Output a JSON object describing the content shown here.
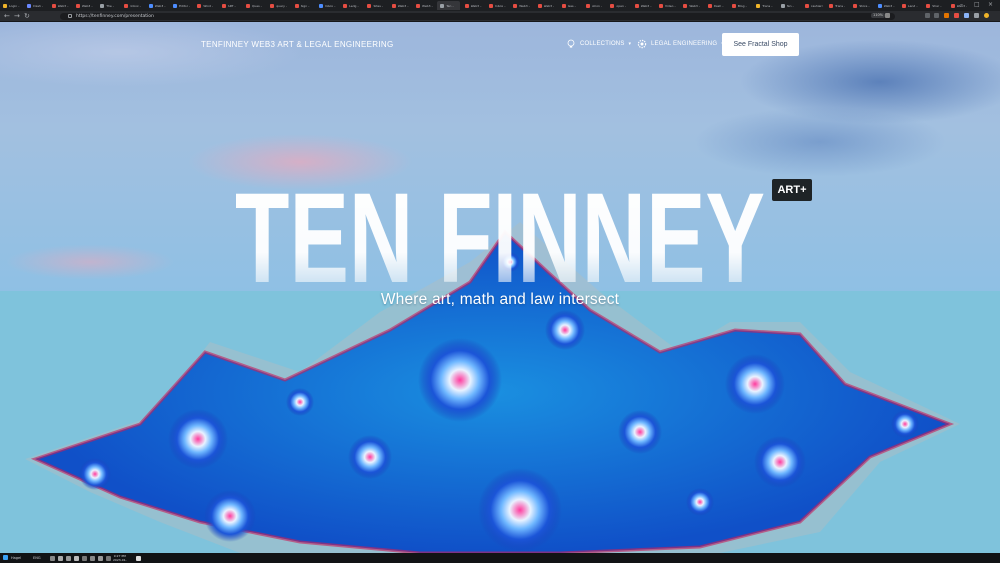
{
  "browser": {
    "tabs": [
      {
        "title": "Login –",
        "color": "#f0b429"
      },
      {
        "title": "Dash –",
        "color": "#6a88ff"
      },
      {
        "title": "Web3 –",
        "color": "#e54d42"
      },
      {
        "title": "Web3 –",
        "color": "#e54d42"
      },
      {
        "title": "The –",
        "color": "#9aa0a6"
      },
      {
        "title": "Inbox –",
        "color": "#e54d42"
      },
      {
        "title": "Web3 –",
        "color": "#4d8dff"
      },
      {
        "title": "Editor –",
        "color": "#4d8dff"
      },
      {
        "title": "Wind –",
        "color": "#e54d42"
      },
      {
        "title": "ART –",
        "color": "#e54d42"
      },
      {
        "title": "Ques –",
        "color": "#e54d42"
      },
      {
        "title": "query –",
        "color": "#e54d42"
      },
      {
        "title": "Sign –",
        "color": "#e54d42"
      },
      {
        "title": "Inbox –",
        "color": "#4d8dff"
      },
      {
        "title": "Ledg –",
        "color": "#e54d42"
      },
      {
        "title": "Sites –",
        "color": "#e54d42"
      },
      {
        "title": "Web3 –",
        "color": "#e54d42"
      },
      {
        "title": "Web3 –",
        "color": "#e54d42"
      },
      {
        "title": "Ten –",
        "color": "#9aa0a6",
        "active": true
      },
      {
        "title": "Web3 –",
        "color": "#e54d42"
      },
      {
        "title": "Inbox –",
        "color": "#e54d42"
      },
      {
        "title": "Web3 –",
        "color": "#e54d42"
      },
      {
        "title": "Web3 –",
        "color": "#e54d42"
      },
      {
        "title": "Gas –",
        "color": "#e54d42"
      },
      {
        "title": "ACon –",
        "color": "#e54d42"
      },
      {
        "title": "open –",
        "color": "#e54d42"
      },
      {
        "title": "Web3 –",
        "color": "#e54d42"
      },
      {
        "title": "Video –",
        "color": "#e54d42"
      },
      {
        "title": "Web3 –",
        "color": "#e54d42"
      },
      {
        "title": "Dash –",
        "color": "#e54d42"
      },
      {
        "title": "Blog –",
        "color": "#e54d42"
      },
      {
        "title": "Trans –",
        "color": "#f0b429"
      },
      {
        "title": "Ten –",
        "color": "#9aa0a6"
      },
      {
        "title": "cashierr –",
        "color": "#e54d42"
      },
      {
        "title": "Trans –",
        "color": "#e54d42"
      },
      {
        "title": "Store –",
        "color": "#e54d42"
      },
      {
        "title": "Web3 –",
        "color": "#4d8dff"
      },
      {
        "title": "Land –",
        "color": "#e54d42"
      },
      {
        "title": "Shar –",
        "color": "#e54d42"
      },
      {
        "title": "Web3 –",
        "color": "#e54d42"
      }
    ],
    "url": "https://tenfinney.com/presentation",
    "zoom": "110%"
  },
  "nav": {
    "brand": "TENFINNEY WEB3 ART & LEGAL ENGINEERING",
    "collections": "COLLECTIONS",
    "legal_engineering": "LEGAL ENGINEERING",
    "shop_button": "See Fractal Shop",
    "icons": {
      "collections": "lightbulb-icon",
      "legal": "gear-icon"
    }
  },
  "hero": {
    "title": "TEN FINNEY",
    "badge": "ART+",
    "tagline": "Where art, math and law intersect"
  },
  "taskbar": {
    "weather": "Hagel",
    "lang": "ENG",
    "time": "9:27 PM",
    "date": "2023-01-"
  }
}
